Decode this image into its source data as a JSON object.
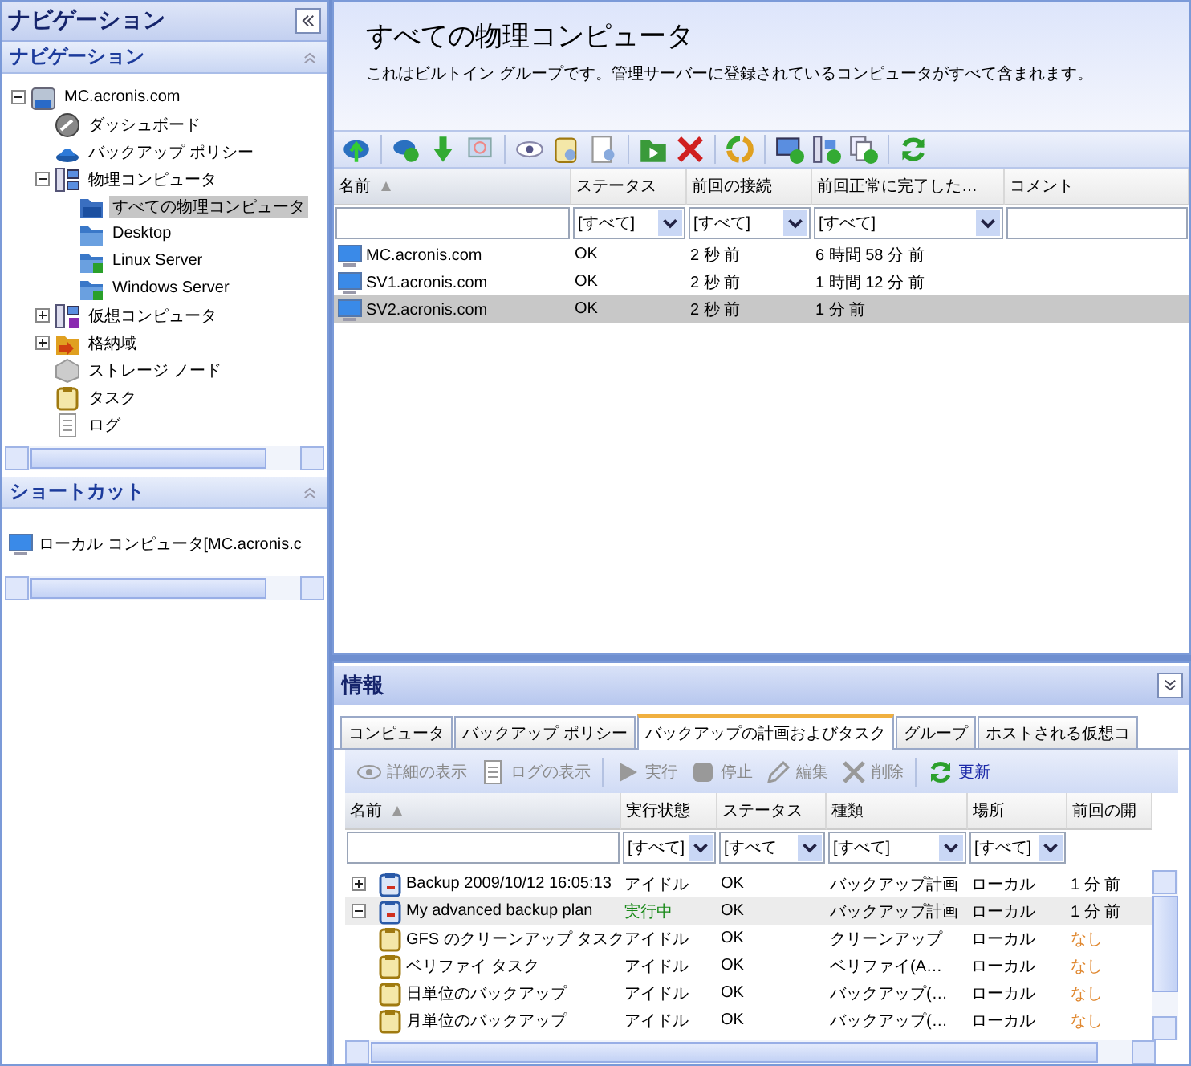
{
  "nav_panel": {
    "title": "ナビゲーション",
    "navigation": {
      "title": "ナビゲーション",
      "tree": [
        {
          "label": "MC.acronis.com",
          "kind": "server",
          "expanded": true,
          "selected": false,
          "children": [
            {
              "label": "ダッシュボード",
              "kind": "dashboard",
              "selected": false
            },
            {
              "label": "バックアップ ポリシー",
              "kind": "policy",
              "selected": false
            },
            {
              "label": "物理コンピュータ",
              "kind": "computers",
              "expanded": true,
              "selected": false,
              "children": [
                {
                  "label": "すべての物理コンピュータ",
                  "kind": "group-all",
                  "selected": true
                },
                {
                  "label": "Desktop",
                  "kind": "folder",
                  "selected": false
                },
                {
                  "label": "Linux Server",
                  "kind": "group-folder",
                  "selected": false
                },
                {
                  "label": "Windows Server",
                  "kind": "group-folder",
                  "selected": false
                }
              ]
            },
            {
              "label": "仮想コンピュータ",
              "kind": "virtual",
              "expanded": false,
              "selected": false
            },
            {
              "label": "格納域",
              "kind": "vault",
              "expanded": false,
              "selected": false
            },
            {
              "label": "ストレージ ノード",
              "kind": "storage-node",
              "selected": false
            },
            {
              "label": "タスク",
              "kind": "task",
              "selected": false
            },
            {
              "label": "ログ",
              "kind": "log",
              "selected": false
            }
          ]
        }
      ]
    },
    "shortcuts": {
      "title": "ショートカット",
      "items": [
        {
          "label": "ローカル コンピュータ[MC.acronis.c"
        }
      ]
    }
  },
  "main": {
    "title": "すべての物理コンピュータ",
    "description": "これはビルトイン グループです。管理サーバーに登録されているコンピュータがすべて含まれます。",
    "table": {
      "columns": [
        {
          "label": "名前",
          "sorted": true
        },
        {
          "label": "ステータス",
          "sorted": false
        },
        {
          "label": "前回の接続",
          "sorted": false
        },
        {
          "label": "前回正常に完了した…",
          "sorted": false
        },
        {
          "label": "コメント",
          "sorted": false
        }
      ],
      "filters": [
        {
          "kind": "text"
        },
        {
          "kind": "select",
          "value": "[すべて]"
        },
        {
          "kind": "select",
          "value": "[すべて]"
        },
        {
          "kind": "select",
          "value": "[すべて]"
        },
        {
          "kind": "text"
        }
      ],
      "rows": [
        {
          "name": "MC.acronis.com",
          "status": "OK",
          "last_connection": "2 秒 前",
          "last_success": "6 時間 58 分 前",
          "selected": false
        },
        {
          "name": "SV1.acronis.com",
          "status": "OK",
          "last_connection": "2 秒 前",
          "last_success": "1 時間 12 分 前",
          "selected": false
        },
        {
          "name": "SV2.acronis.com",
          "status": "OK",
          "last_connection": "2 秒 前",
          "last_success": "1 分 前",
          "selected": true
        }
      ]
    }
  },
  "info_panel": {
    "title": "情報",
    "tabs": [
      {
        "label": "コンピュータ",
        "selected": false
      },
      {
        "label": "バックアップ ポリシー",
        "selected": false
      },
      {
        "label": "バックアップの計画およびタスク",
        "selected": true
      },
      {
        "label": "グループ",
        "selected": false
      },
      {
        "label": "ホストされる仮想コ",
        "selected": false
      }
    ],
    "toolbar": [
      {
        "label": "詳細の表示",
        "kind": "eye",
        "disabled": true
      },
      {
        "label": "ログの表示",
        "kind": "log",
        "disabled": true
      },
      {
        "label": "実行",
        "kind": "run",
        "disabled": true
      },
      {
        "label": "停止",
        "kind": "stop",
        "disabled": true
      },
      {
        "label": "編集",
        "kind": "edit",
        "disabled": true
      },
      {
        "label": "削除",
        "kind": "delete",
        "disabled": true
      },
      {
        "label": "更新",
        "kind": "refresh",
        "disabled": false
      }
    ],
    "columns": [
      {
        "label": "名前",
        "sorted": true
      },
      {
        "label": "実行状態",
        "sorted": false
      },
      {
        "label": "ステータス",
        "sorted": false
      },
      {
        "label": "種類",
        "sorted": false
      },
      {
        "label": "場所",
        "sorted": false
      },
      {
        "label": "前回の開",
        "sorted": false
      }
    ],
    "filters": [
      {
        "kind": "text"
      },
      {
        "kind": "select",
        "value": "[すべて]"
      },
      {
        "kind": "select",
        "value": "[すべて"
      },
      {
        "kind": "select",
        "value": "[すべて]"
      },
      {
        "kind": "select",
        "value": "[すべて]"
      },
      {
        "kind": "none"
      }
    ],
    "rows": [
      {
        "name": "Backup 2009/10/12 16:05:13",
        "kind": "plan",
        "expanded": false,
        "state": "アイドル",
        "running": false,
        "status": "OK",
        "type": "バックアップ計画",
        "location": "ローカル",
        "last_start": "1 分 前",
        "never": false,
        "selected": false
      },
      {
        "name": "My advanced backup plan",
        "kind": "plan",
        "expanded": true,
        "state": "実行中",
        "running": true,
        "status": "OK",
        "type": "バックアップ計画",
        "location": "ローカル",
        "last_start": "1 分 前",
        "never": false,
        "selected": true,
        "children": [
          {
            "name": "GFS のクリーンアップ タスク",
            "kind": "task",
            "state": "アイドル",
            "running": false,
            "status": "OK",
            "type": "クリーンアップ",
            "location": "ローカル",
            "last_start": "なし",
            "never": true,
            "selected": false
          },
          {
            "name": "ベリファイ タスク",
            "kind": "task",
            "state": "アイドル",
            "running": false,
            "status": "OK",
            "type": "ベリファイ(A…",
            "location": "ローカル",
            "last_start": "なし",
            "never": true,
            "selected": false
          },
          {
            "name": "日単位のバックアップ",
            "kind": "task",
            "state": "アイドル",
            "running": false,
            "status": "OK",
            "type": "バックアップ(…",
            "location": "ローカル",
            "last_start": "なし",
            "never": true,
            "selected": false
          },
          {
            "name": "月単位のバックアップ",
            "kind": "task",
            "state": "アイドル",
            "running": false,
            "status": "OK",
            "type": "バックアップ(…",
            "location": "ローカル",
            "last_start": "なし",
            "never": true,
            "selected": false
          }
        ]
      }
    ]
  }
}
